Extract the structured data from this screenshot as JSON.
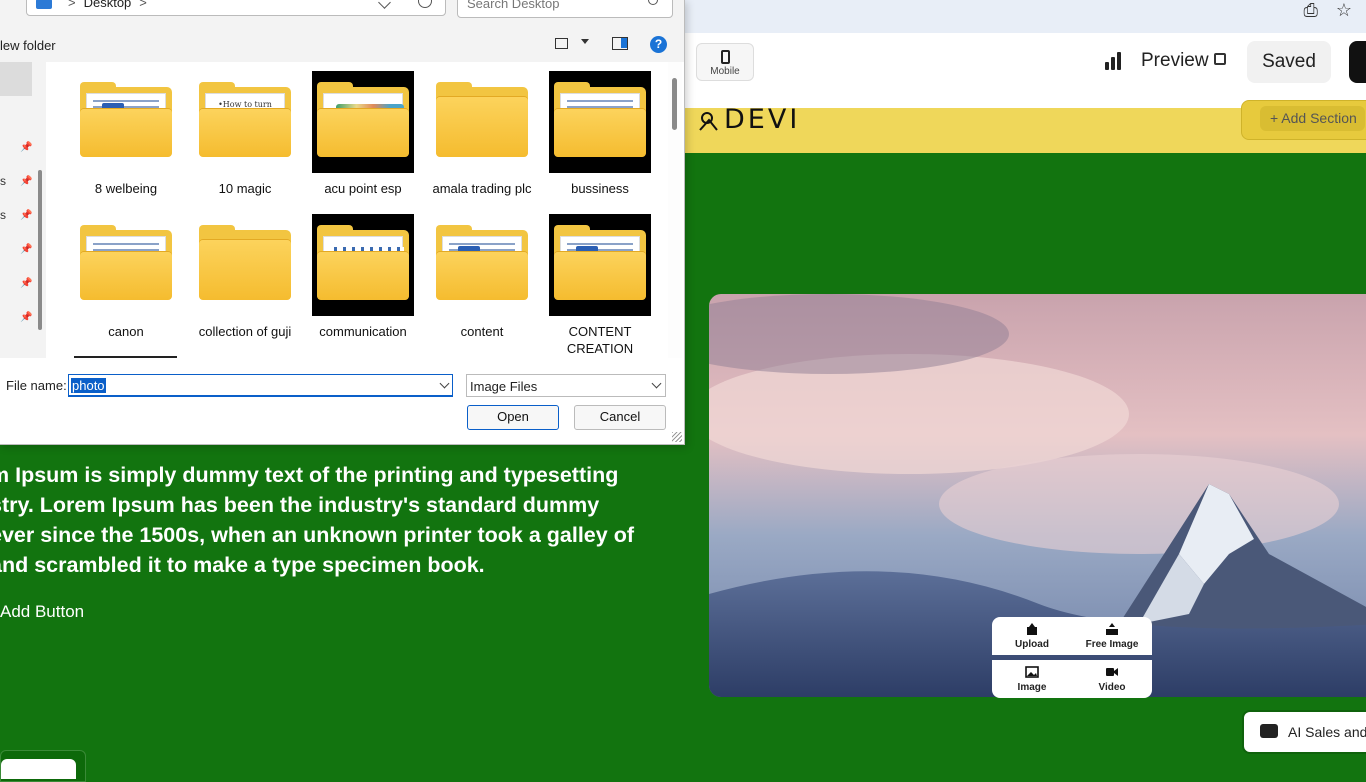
{
  "editor": {
    "mobile_label": "Mobile",
    "preview_label": "Preview",
    "saved_label": "Saved",
    "logo_text": "DEVI",
    "add_section_label": "Add Section",
    "body_lines": [
      "m Ipsum is simply dummy text of the printing and typesetting",
      "stry. Lorem Ipsum has been the industry's standard dummy",
      "ever since the 1500s, when an unknown printer took a galley of",
      " and scrambled it to make a type specimen book."
    ],
    "add_button_label": "Add Button",
    "ai_chat_label": "AI Sales and",
    "media_menu": {
      "upload": "Upload",
      "free_image": "Free Image",
      "image": "Image",
      "video": "Video"
    },
    "colors": {
      "header_yellow": "#efd75a",
      "page_green": "#12740f"
    }
  },
  "dialog": {
    "path": [
      "Desktop"
    ],
    "search_placeholder": "Search Desktop",
    "new_folder_label": "lew folder",
    "nav_labels": [
      "s",
      "s"
    ],
    "files": [
      {
        "name": "8 welbeing"
      },
      {
        "name": "10 magic",
        "thumb_text": "•How to turn words"
      },
      {
        "name": "acu point esp"
      },
      {
        "name": "amala trading plc"
      },
      {
        "name": "bussiness"
      },
      {
        "name": "canon"
      },
      {
        "name": "collection of guji"
      },
      {
        "name": "communication"
      },
      {
        "name": "content"
      },
      {
        "name": "CONTENT CREATION"
      }
    ],
    "filename_label": "File name:",
    "filename_value": "photo",
    "filetype_value": "Image Files",
    "open_label": "Open",
    "cancel_label": "Cancel"
  }
}
